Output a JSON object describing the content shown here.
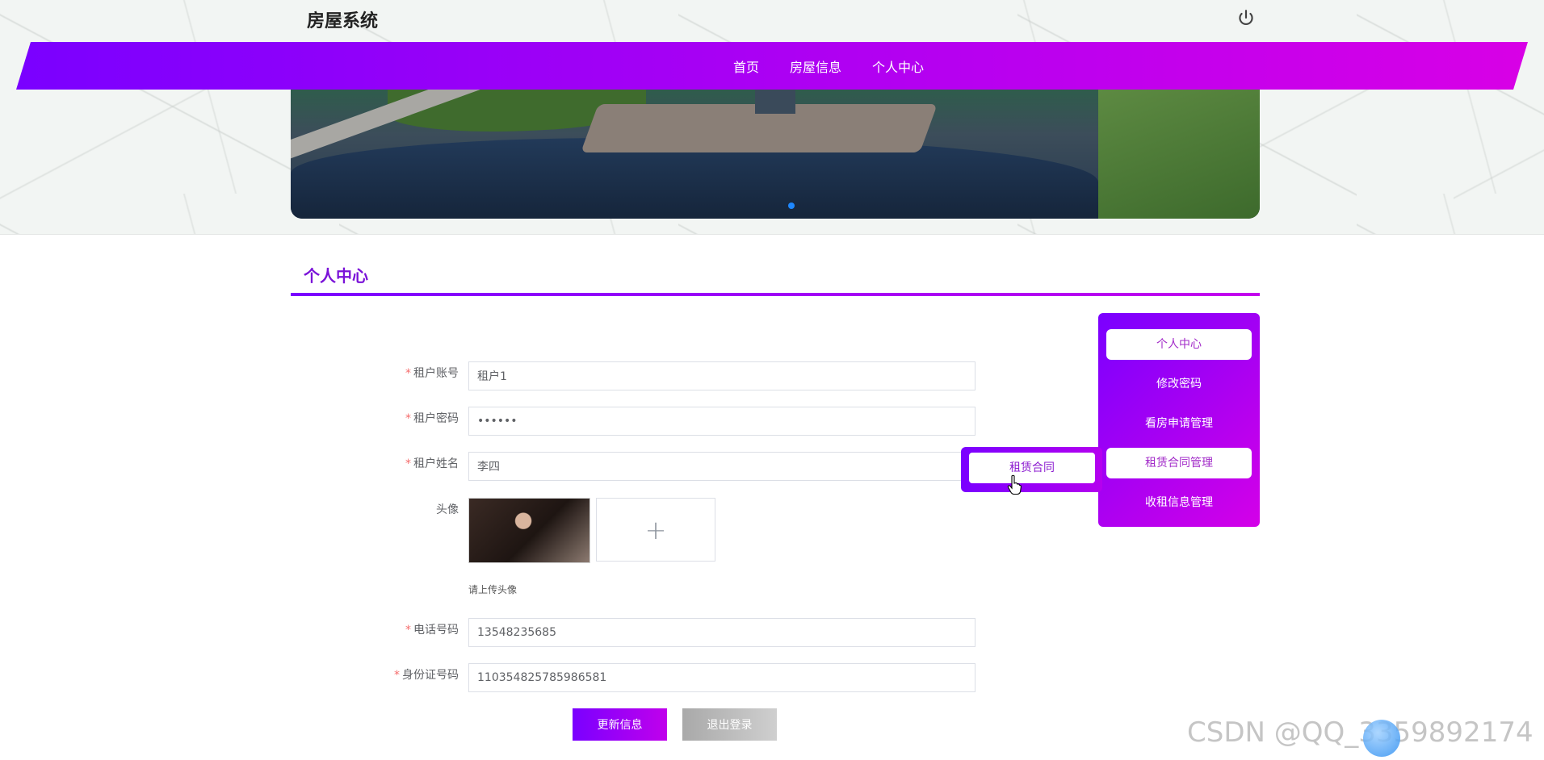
{
  "header": {
    "brand": "房屋系统"
  },
  "nav": {
    "items": [
      "首页",
      "房屋信息",
      "个人中心"
    ]
  },
  "page": {
    "title": "个人中心"
  },
  "form": {
    "account": {
      "label": "租户账号",
      "value": "租户1"
    },
    "password": {
      "label": "租户密码",
      "value": "••••••"
    },
    "name": {
      "label": "租户姓名",
      "value": "李四"
    },
    "avatar": {
      "label": "头像",
      "tip": "请上传头像",
      "upload_symbol": "+"
    },
    "phone": {
      "label": "电话号码",
      "value": "13548235685"
    },
    "idcard": {
      "label": "身份证号码",
      "value": "110354825785986581"
    },
    "required_mark": "*",
    "update_button": "更新信息",
    "logout_button": "退出登录"
  },
  "side_menu": {
    "items": [
      "个人中心",
      "修改密码",
      "看房申请管理",
      "租赁合同管理",
      "收租信息管理"
    ],
    "active_index": 0,
    "hover_index": 3
  },
  "popup": {
    "item": "租赁合同"
  },
  "watermark": "CSDN @QQ_3359892174",
  "colors": {
    "accent_start": "#7a00ff",
    "accent_end": "#d800e6",
    "title": "#7a12d8",
    "required": "#f56c6c"
  },
  "icons": {
    "power": "power-icon",
    "cursor": "hand-cursor-icon",
    "upload": "plus-icon"
  }
}
